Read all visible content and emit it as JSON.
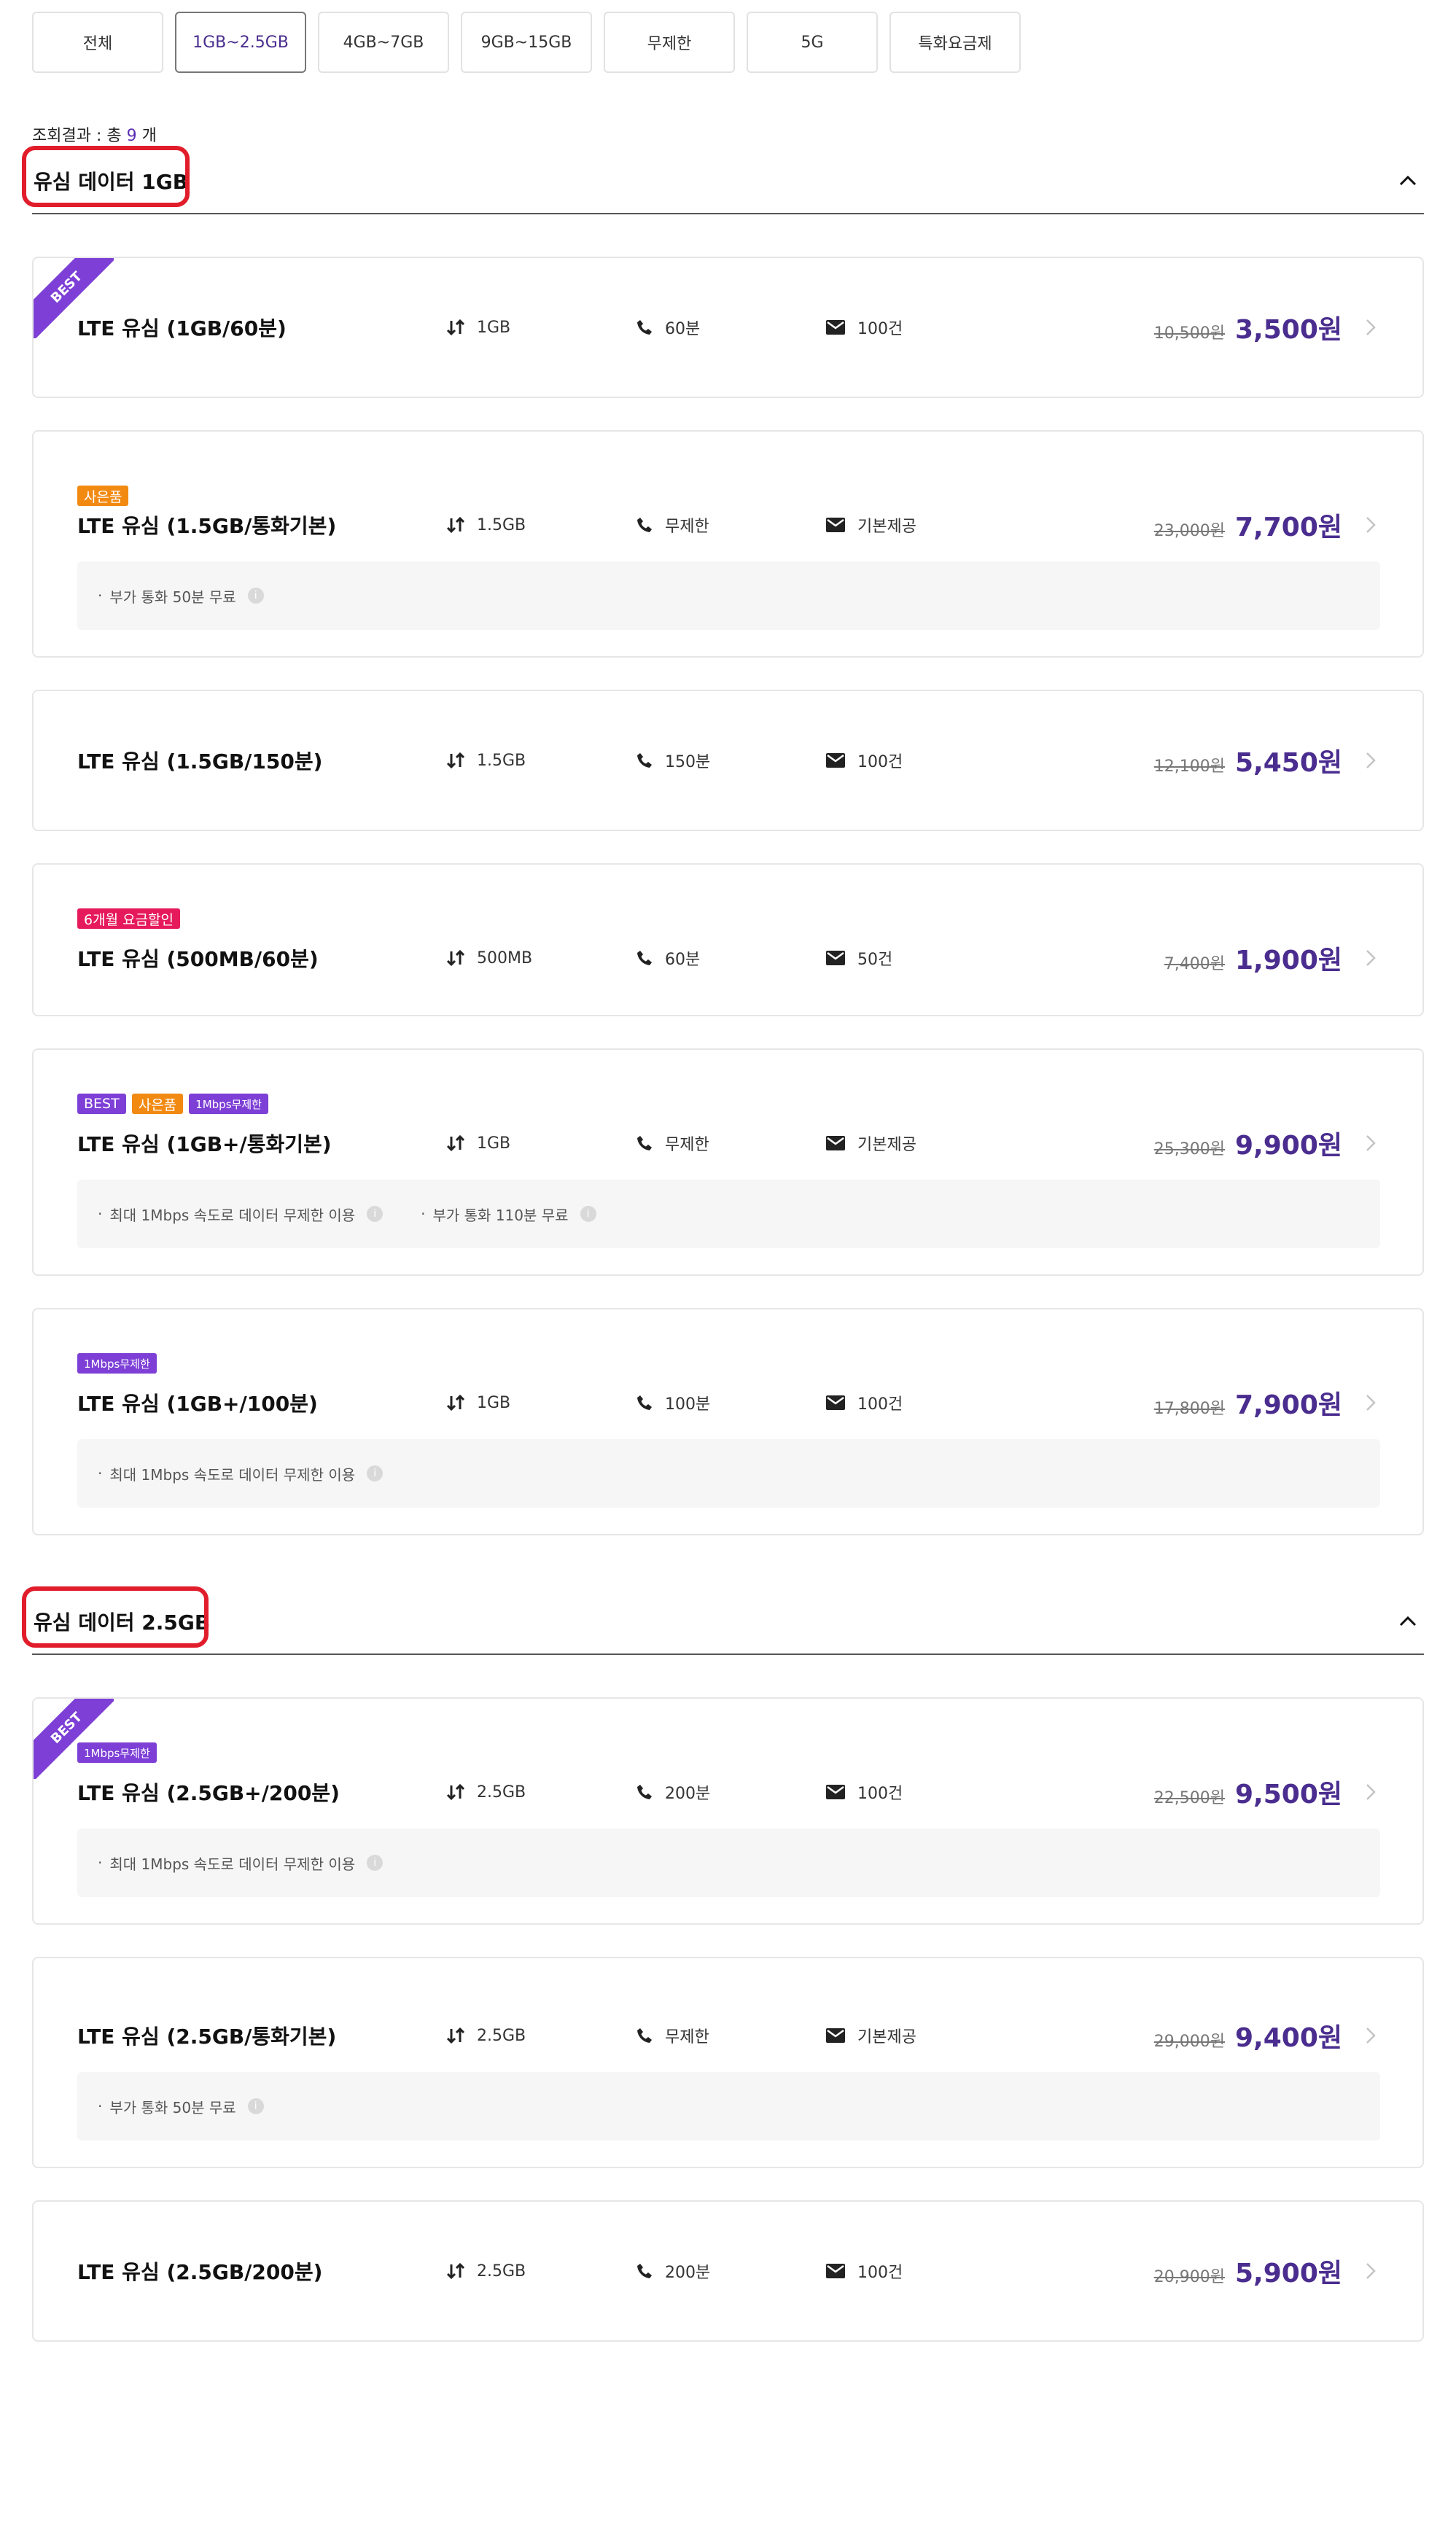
{
  "tabs": [
    {
      "label": "전체"
    },
    {
      "label": "1GB~2.5GB"
    },
    {
      "label": "4GB~7GB"
    },
    {
      "label": "9GB~15GB"
    },
    {
      "label": "무제한"
    },
    {
      "label": "5G"
    },
    {
      "label": "특화요금제"
    }
  ],
  "active_tab": "1GB~2.5GB",
  "result": {
    "prefix": "조회결과 : 총",
    "count": "9",
    "suffix": "개"
  },
  "sections": [
    {
      "title": "유심 데이터 1GB",
      "plans": [
        {
          "name": "LTE 유심 (1GB/60분)",
          "data": "1GB",
          "voice": "60분",
          "sms": "100건",
          "old_price": "10,500원",
          "price": "3,500원",
          "ribbon": "BEST"
        },
        {
          "name": "LTE 유심 (1.5GB/통화기본)",
          "data": "1.5GB",
          "voice": "무제한",
          "sms": "기본제공",
          "old_price": "23,000원",
          "price": "7,700원",
          "badges": [
            "사은품"
          ],
          "notes": [
            "부가 통화 50분 무료"
          ]
        },
        {
          "name": "LTE 유심 (1.5GB/150분)",
          "data": "1.5GB",
          "voice": "150분",
          "sms": "100건",
          "old_price": "12,100원",
          "price": "5,450원"
        },
        {
          "name": "LTE 유심 (500MB/60분)",
          "data": "500MB",
          "voice": "60분",
          "sms": "50건",
          "old_price": "7,400원",
          "price": "1,900원",
          "badges": [
            "6개월 요금할인"
          ]
        },
        {
          "name": "LTE 유심 (1GB+/통화기본)",
          "data": "1GB",
          "voice": "무제한",
          "sms": "기본제공",
          "old_price": "25,300원",
          "price": "9,900원",
          "badges": [
            "BEST",
            "사은품",
            "1Mbps무제한"
          ],
          "notes": [
            "최대 1Mbps 속도로 데이터 무제한 이용",
            "부가 통화 110분 무료"
          ]
        },
        {
          "name": "LTE 유심 (1GB+/100분)",
          "data": "1GB",
          "voice": "100분",
          "sms": "100건",
          "old_price": "17,800원",
          "price": "7,900원",
          "badges": [
            "1Mbps무제한"
          ],
          "notes": [
            "최대 1Mbps 속도로 데이터 무제한 이용"
          ]
        }
      ]
    },
    {
      "title": "유심 데이터 2.5GB",
      "plans": [
        {
          "name": "LTE 유심 (2.5GB+/200분)",
          "data": "2.5GB",
          "voice": "200분",
          "sms": "100건",
          "old_price": "22,500원",
          "price": "9,500원",
          "ribbon": "BEST",
          "badges": [
            "1Mbps무제한"
          ],
          "notes": [
            "최대 1Mbps 속도로 데이터 무제한 이용"
          ]
        },
        {
          "name": "LTE 유심 (2.5GB/통화기본)",
          "data": "2.5GB",
          "voice": "무제한",
          "sms": "기본제공",
          "old_price": "29,000원",
          "price": "9,400원",
          "notes": [
            "부가 통화 50분 무료"
          ]
        },
        {
          "name": "LTE 유심 (2.5GB/200분)",
          "data": "2.5GB",
          "voice": "200분",
          "sms": "100건",
          "old_price": "20,900원",
          "price": "5,900원"
        }
      ]
    }
  ],
  "colors": {
    "accent": "#4a2d8f",
    "best": "#7d3fd6",
    "gift": "#f28a12",
    "discount": "#e5195b",
    "highlight": "#e11d2b"
  },
  "icons": {
    "data": "data-arrows-icon",
    "voice": "phone-icon",
    "sms": "envelope-icon",
    "info": "info-icon"
  }
}
